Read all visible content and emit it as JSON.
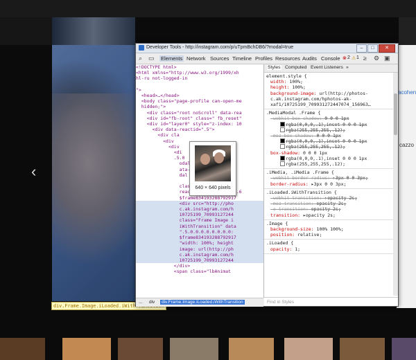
{
  "devtools": {
    "window_title": "Developer Tools - http://instagram.com/p/uTpmBchDB6/?modal=true",
    "tabs": [
      "Elements",
      "Network",
      "Sources",
      "Timeline",
      "Profiles",
      "Resources",
      "Audits",
      "Console"
    ],
    "active_tab": "Elements",
    "error_count": "2",
    "warning_count": "1",
    "subtabs": [
      "Styles",
      "Computed",
      "Event Listeners"
    ],
    "find_placeholder": "Find in Styles",
    "breadcrumb": [
      "...",
      "div",
      "div.Frame.Image.iLoaded.iWithTransition"
    ],
    "image_tooltip": "640 × 640 pixels",
    "status_label": "div.Frame.Image.iLoaded.iWithTransition"
  },
  "dom_lines": [
    "<!DOCTYPE html>",
    "<html xmlns=\"http://www.w3.org/1999/xh",
    "hl-ru not-logged-in",
    "",
    "\">",
    "  <head>…</head>",
    "  <body class=\"page-profile can-open-me",
    "  hidden;\">",
    "    <div class=\"root noScroll\" data-rea",
    "    <div id=\"fb-root\" class=\" fb_reset\"",
    "    <div id=\"layer0\" style=\"z-index: 10",
    "      <div data-reactid=\".5\">",
    "        <div cla",
    "          <div",
    "            <div",
    "              <di",
    "              .5.0",
    "                odal Mo",
    "                ata-",
    "                dal",
    "                ",
    "                class=\"iMedia Li",
    "                reactid=\".5.0.0.0.0.0.6",
    "                $frame834193288792917",
    "                <div src=\"http://pho",
    "                c.ak.instagram.com/h",
    "                10725199_70993127244",
    "                class=\"Frame Image i",
    "                iWithTransition\" data",
    "                \".5.0.0.0.0.0.0.0.0:",
    "                $frame834193288792917",
    "                \"width: 100%; height",
    "                image: url(http://ph",
    "                c.ak.instagram.com/h",
    "                10725199_70993127244",
    "              </div>",
    "              <span class=\"lbAnimat"
  ],
  "styles": [
    {
      "selector": "element.style {",
      "props": [
        {
          "name": "width",
          "value": "100%;"
        },
        {
          "name": "height",
          "value": "100%;"
        },
        {
          "name": "background-image",
          "value": "url(http://photos-c.ak.instagram.com/hphotos-ak-xaf1/10725199_709931272447074_156963…"
        }
      ]
    },
    {
      "selector": ".MediaModal .Frame {",
      "props": [
        {
          "name": "-webkit-box-shadow",
          "value": "0 0 0 1px",
          "struck": true
        },
        {
          "name": "",
          "value": "rgba(0,0,0,.1),inset 0 0 0 1px",
          "struck": true,
          "swatch": "#000000"
        },
        {
          "name": "",
          "value": "rgba(255,255,255,.12);",
          "struck": true,
          "swatch": "#ffffff"
        },
        {
          "name": "-moz-box-shadow",
          "value": "0 0 0 1px",
          "struck": true
        },
        {
          "name": "",
          "value": "rgba(0,0,0,.1),inset 0 0 0 1px",
          "struck": true,
          "swatch": "#000000"
        },
        {
          "name": "",
          "value": "rgba(255,255,255,.12);",
          "struck": true,
          "swatch": "#ffffff"
        },
        {
          "name": "box-shadow",
          "value": "0 0 0 1px"
        },
        {
          "name": "",
          "value": "rgba(0,0,0,.1),inset 0 0 0 1px",
          "swatch": "#000000"
        },
        {
          "name": "",
          "value": "rgba(255,255,255,.12);",
          "swatch": "#ffffff"
        }
      ]
    },
    {
      "selector": ".iMedia, .iMedia .Frame {",
      "props": [
        {
          "name": "-webkit-border-radius",
          "value": "▸3px 0 0 3px;",
          "struck": true
        },
        {
          "name": "border-radius",
          "value": "▸3px 0 0 3px;"
        }
      ]
    },
    {
      "selector": ".iLoaded.iWithTransition {",
      "props": [
        {
          "name": "-webkit-transition",
          "value": "▸opacity 2s;",
          "struck": true
        },
        {
          "name": "-moz-transition",
          "value": "opacity 2s;",
          "struck": true
        },
        {
          "name": "-o-transition",
          "value": "opacity 2s;",
          "struck": true
        },
        {
          "name": "transition",
          "value": "▸opacity 2s;"
        }
      ]
    },
    {
      "selector": ".Image {",
      "props": [
        {
          "name": "background-size",
          "value": "100% 100%;"
        },
        {
          "name": "position",
          "value": "relative;"
        }
      ]
    },
    {
      "selector": ".iLoaded {",
      "props": [
        {
          "name": "opacity",
          "value": "1;"
        }
      ]
    }
  ],
  "background_page": {
    "right_text_1": "acohen",
    "right_text_2": "cazzo"
  }
}
